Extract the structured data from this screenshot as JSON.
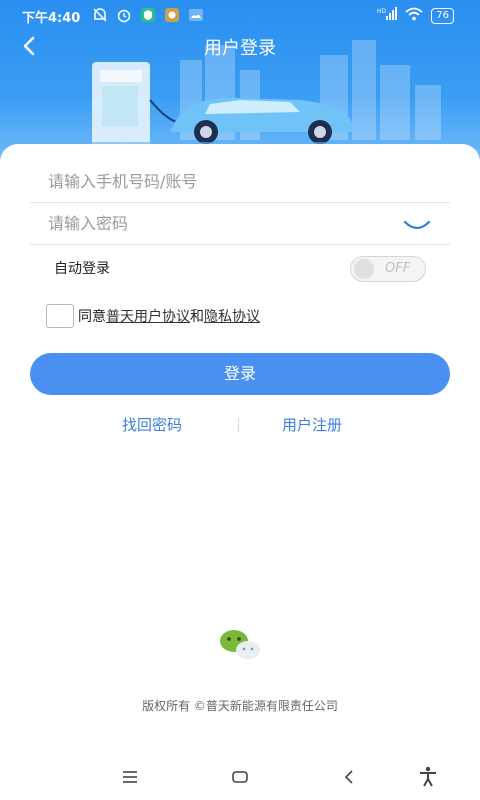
{
  "status": {
    "time": "下午4:40",
    "battery": "76",
    "network": "HD"
  },
  "header": {
    "title": "用户登录"
  },
  "form": {
    "phone_placeholder": "请输入手机号码/账号",
    "password_placeholder": "请输入密码",
    "auto_login_label": "自动登录",
    "toggle_state": "OFF",
    "agree_prefix": "同意",
    "user_agreement": "普天用户协议",
    "and_text": "和",
    "privacy_agreement": "隐私协议",
    "login_button": "登录"
  },
  "links": {
    "recover_password": "找回密码",
    "register": "用户注册"
  },
  "footer": {
    "copyright": "版权所有 ©普天新能源有限责任公司"
  },
  "colors": {
    "primary": "#4a90f0",
    "header_top": "#2a8ff0",
    "link": "#3a7fe0",
    "wechat": "#7bb83a"
  },
  "icons": {
    "back": "chevron-left-icon",
    "password_visibility": "eye-closed-icon",
    "social_login": "wechat-icon",
    "nav": [
      "menu-icon",
      "home-icon",
      "back-icon",
      "accessibility-icon"
    ]
  }
}
